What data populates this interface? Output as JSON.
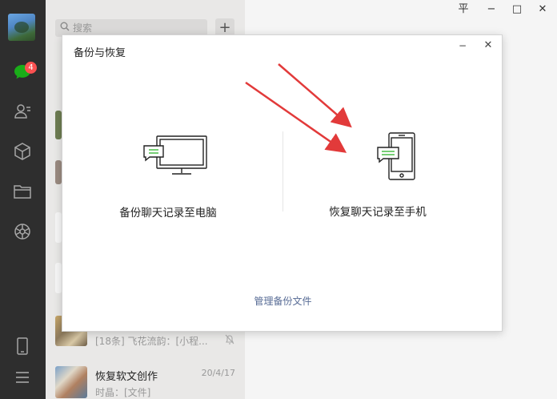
{
  "sidebar": {
    "chat_badge": "4"
  },
  "chat_list": {
    "search_placeholder": "搜索",
    "add_button": "+",
    "items": [
      {
        "name": "",
        "date": "",
        "preview": "[18条] 飞花流韵：[小程..."
      },
      {
        "name": "恢复软文创作",
        "date": "20/4/17",
        "preview": "时晶：[文件]"
      }
    ]
  },
  "window": {
    "pin": "平",
    "minimize": "−",
    "maximize": "□",
    "close": "✕"
  },
  "dialog": {
    "title": "备份与恢复",
    "minimize": "−",
    "close": "✕",
    "backup_label": "备份聊天记录至电脑",
    "restore_label": "恢复聊天记录至手机",
    "manage_link": "管理备份文件"
  },
  "colors": {
    "sidebar_bg": "#2e2e2e",
    "wechat_green": "#1aad19",
    "badge_red": "#fa5151",
    "link_blue": "#576b95",
    "arrow_red": "#e23a3a"
  }
}
